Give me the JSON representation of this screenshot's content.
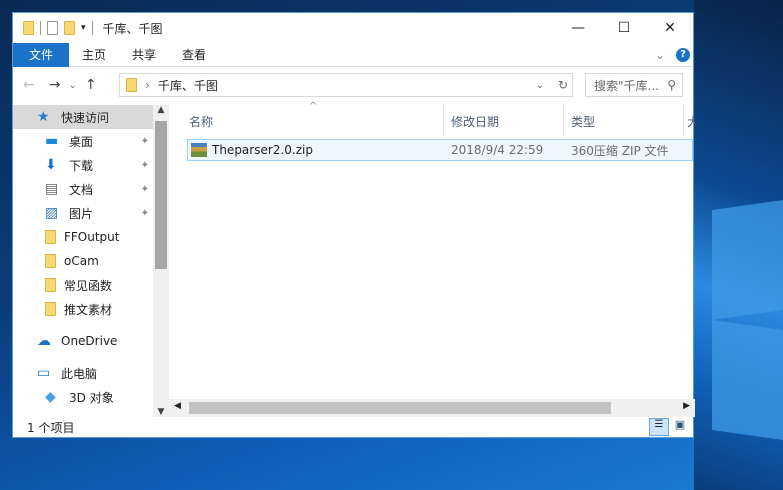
{
  "window": {
    "title": "千库、千图",
    "minimize": "—",
    "maximize": "☐",
    "close": "✕"
  },
  "ribbon": {
    "tabs": [
      "文件",
      "主页",
      "共享",
      "查看"
    ],
    "expand": "⌄",
    "help": "?"
  },
  "nav": {
    "back": "←",
    "forward": "→",
    "recent": "⌄",
    "up": "↑",
    "breadcrumb_sep": "›",
    "path": "千库、千图",
    "refresh": "↻",
    "dropdown": "⌄",
    "search_placeholder": "搜索\"千库...",
    "search_icon": "⚲"
  },
  "sidebar": {
    "items": [
      {
        "label": "快速访问",
        "icon": "star-icon"
      },
      {
        "label": "桌面",
        "icon": "desktop-icon",
        "pinned": true
      },
      {
        "label": "下载",
        "icon": "download-icon",
        "pinned": true
      },
      {
        "label": "文档",
        "icon": "document-icon",
        "pinned": true
      },
      {
        "label": "图片",
        "icon": "pictures-icon",
        "pinned": true
      },
      {
        "label": "FFOutput",
        "icon": "folder-icon"
      },
      {
        "label": "oCam",
        "icon": "folder-icon"
      },
      {
        "label": "常见函数",
        "icon": "folder-icon"
      },
      {
        "label": "推文素材",
        "icon": "folder-icon"
      },
      {
        "label": "OneDrive",
        "icon": "cloud-icon"
      },
      {
        "label": "此电脑",
        "icon": "computer-icon"
      },
      {
        "label": "3D 对象",
        "icon": "3d-icon"
      }
    ],
    "pin_glyph": "📌"
  },
  "columns": {
    "name": "名称",
    "date": "修改日期",
    "type": "类型",
    "size": "大"
  },
  "files": [
    {
      "name": "Theparser2.0.zip",
      "date": "2018/9/4 22:59",
      "type": "360压缩 ZIP 文件"
    }
  ],
  "status": {
    "count": "1 个项目"
  }
}
